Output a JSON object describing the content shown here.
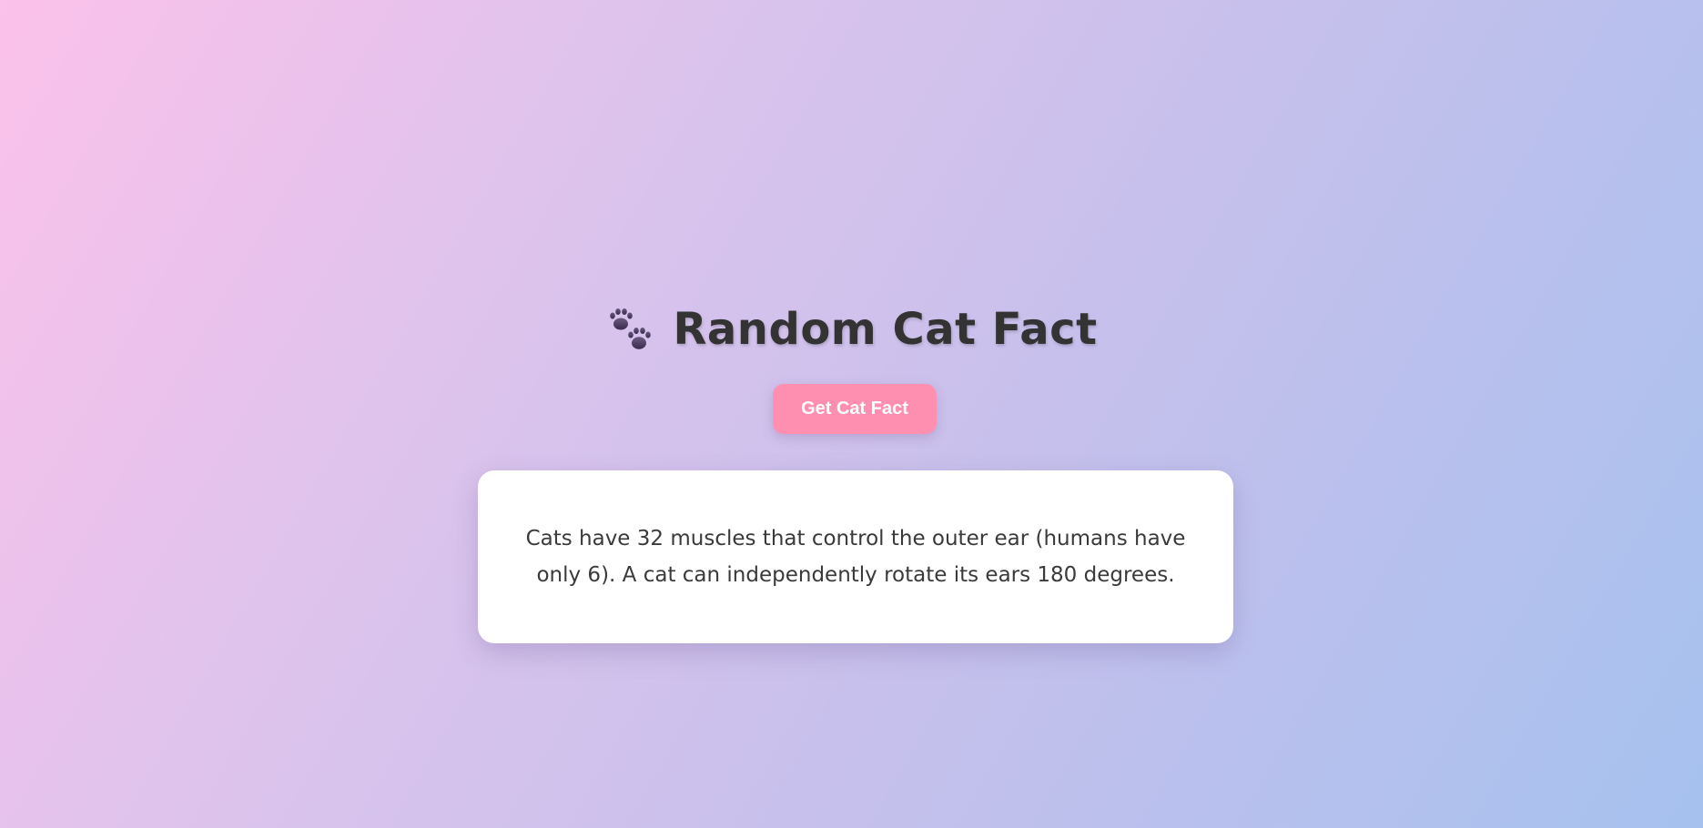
{
  "header": {
    "icon": "paw-prints-icon",
    "title": "Random Cat Fact"
  },
  "actions": {
    "get_fact_label": "Get Cat Fact"
  },
  "fact_card": {
    "text": "Cats have 32 muscles that control the outer ear (humans have only 6). A cat can independently rotate its ears 180 degrees."
  },
  "colors": {
    "background_gradient_start": "#fbc2eb",
    "background_gradient_end": "#a6c1ee",
    "button_bg": "#ff8fb1",
    "button_text": "#ffffff",
    "title_text": "#333333",
    "card_bg": "#ffffff",
    "icon_color": "#4a3a5c"
  }
}
